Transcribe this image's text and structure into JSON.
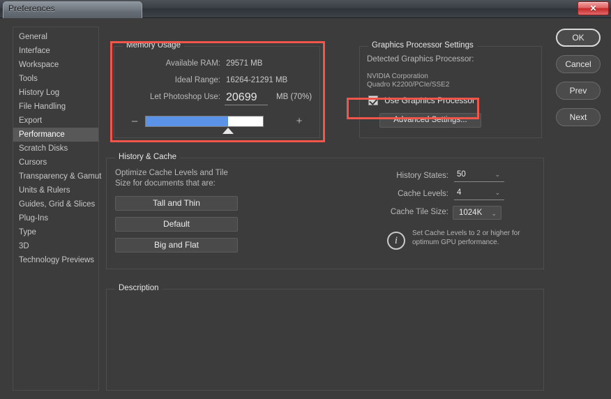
{
  "window": {
    "title": "Preferences",
    "close_label": "✕"
  },
  "sidebar": {
    "items": [
      {
        "label": "General",
        "selected": false
      },
      {
        "label": "Interface",
        "selected": false
      },
      {
        "label": "Workspace",
        "selected": false
      },
      {
        "label": "Tools",
        "selected": false
      },
      {
        "label": "History Log",
        "selected": false
      },
      {
        "label": "File Handling",
        "selected": false
      },
      {
        "label": "Export",
        "selected": false
      },
      {
        "label": "Performance",
        "selected": true
      },
      {
        "label": "Scratch Disks",
        "selected": false
      },
      {
        "label": "Cursors",
        "selected": false
      },
      {
        "label": "Transparency & Gamut",
        "selected": false
      },
      {
        "label": "Units & Rulers",
        "selected": false
      },
      {
        "label": "Guides, Grid & Slices",
        "selected": false
      },
      {
        "label": "Plug-Ins",
        "selected": false
      },
      {
        "label": "Type",
        "selected": false
      },
      {
        "label": "3D",
        "selected": false
      },
      {
        "label": "Technology Previews",
        "selected": false
      }
    ]
  },
  "memory_usage": {
    "title": "Memory Usage",
    "available_ram_label": "Available RAM:",
    "available_ram_value": "29571 MB",
    "ideal_range_label": "Ideal Range:",
    "ideal_range_value": "16264-21291 MB",
    "let_use_label": "Let Photoshop Use:",
    "let_use_value": "20699",
    "let_use_suffix": "MB (70%)",
    "slider_minus": "–",
    "slider_plus": "+",
    "slider_percent": 70,
    "slider_fill_color": "#5b93e8"
  },
  "graphics_processor": {
    "title": "Graphics Processor Settings",
    "detected_label": "Detected Graphics Processor:",
    "vendor": "NVIDIA Corporation",
    "model": "Quadro K2200/PCIe/SSE2",
    "use_gpu_label": "Use Graphics Processor",
    "use_gpu_checked": true,
    "advanced_settings_label": "Advanced Settings..."
  },
  "history_cache": {
    "title": "History & Cache",
    "optimize_line1": "Optimize Cache Levels and Tile",
    "optimize_line2": "Size for documents that are:",
    "buttons": [
      {
        "label": "Tall and Thin"
      },
      {
        "label": "Default"
      },
      {
        "label": "Big and Flat"
      }
    ],
    "history_states_label": "History States:",
    "history_states_value": "50",
    "cache_levels_label": "Cache Levels:",
    "cache_levels_value": "4",
    "cache_tile_label": "Cache Tile Size:",
    "cache_tile_value": "1024K",
    "chevron": "⌄",
    "info_glyph": "i",
    "info_line1": "Set Cache Levels to 2 or higher for",
    "info_line2": "optimum GPU performance."
  },
  "description": {
    "title": "Description",
    "text": ""
  },
  "actions": {
    "ok": "OK",
    "cancel": "Cancel",
    "prev": "Prev",
    "next": "Next"
  },
  "annotations": {
    "color": "#f2564a",
    "memory_box": "memory-usage-highlight",
    "gpu_box": "use-graphics-processor-highlight"
  }
}
